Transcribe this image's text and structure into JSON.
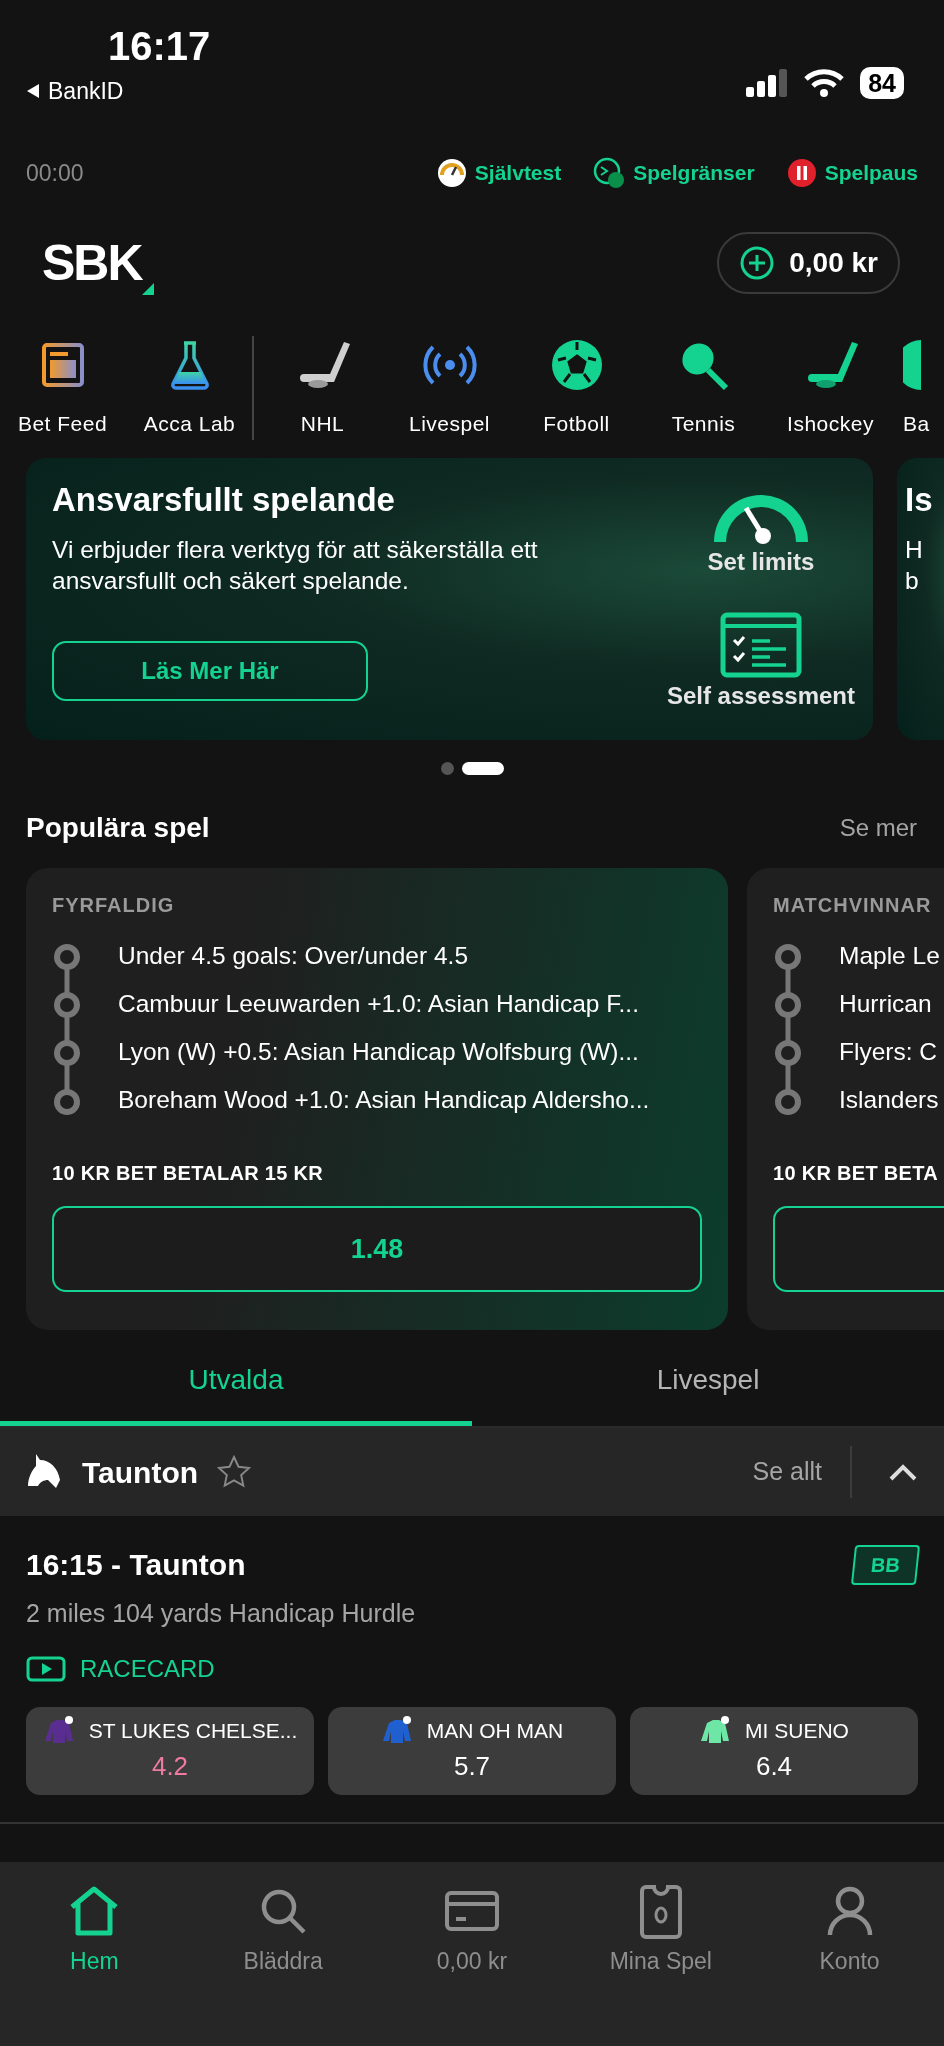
{
  "status_bar": {
    "time": "16:17",
    "back_label": "BankID",
    "battery": "84"
  },
  "top_links": {
    "timer": "00:00",
    "links": [
      {
        "label": "Självtest",
        "kind": "gauge"
      },
      {
        "label": "Spelgränser",
        "kind": "limits"
      },
      {
        "label": "Spelpaus",
        "kind": "pause"
      }
    ]
  },
  "header": {
    "logo": "SBK",
    "balance": "0,00 kr"
  },
  "categories": [
    {
      "label": "Bet Feed",
      "kind": "feed",
      "divider_after": false
    },
    {
      "label": "Acca Lab",
      "kind": "flask",
      "divider_after": true
    },
    {
      "label": "NHL",
      "kind": "hockey-grey",
      "divider_after": false
    },
    {
      "label": "Livespel",
      "kind": "live",
      "divider_after": false
    },
    {
      "label": "Fotboll",
      "kind": "football",
      "divider_after": false
    },
    {
      "label": "Tennis",
      "kind": "tennis",
      "divider_after": false
    },
    {
      "label": "Ishockey",
      "kind": "hockey",
      "divider_after": false
    },
    {
      "label": "Ba",
      "kind": "ball",
      "divider_after": false
    }
  ],
  "banners": [
    {
      "title": "Ansvarsfullt spelande",
      "text": "Vi erbjuder flera verktyg för att säkerställa ett ansvarsfullt och säkert spelande.",
      "button": "Läs Mer Här",
      "features": [
        {
          "label": "Set limits",
          "kind": "gauge"
        },
        {
          "label": "Self assessment",
          "kind": "checklist"
        }
      ]
    },
    {
      "title": "Is",
      "lines": [
        "H",
        "b"
      ]
    }
  ],
  "carousel_dots": [
    {
      "selected": false
    },
    {
      "selected": true
    }
  ],
  "popular": {
    "title": "Populära spel",
    "more": "Se mer",
    "cards": [
      {
        "type": "FYRFALDIG",
        "legs": [
          "Under 4.5 goals: Over/under 4.5",
          "Cambuur Leeuwarden +1.0: Asian Handicap F...",
          "Lyon (W) +0.5: Asian Handicap Wolfsburg (W)...",
          "Boreham Wood +1.0: Asian Handicap Aldersho..."
        ],
        "payout": "10 KR BET BETALAR 15 KR",
        "odds": "1.48"
      },
      {
        "type": "MATCHVINNAR",
        "legs": [
          "Maple Le",
          "Hurrican",
          "Flyers: C",
          "Islanders"
        ],
        "payout": "10 KR BET BETA"
      }
    ]
  },
  "tabs": [
    {
      "label": "Utvalda",
      "selected": true
    },
    {
      "label": "Livespel",
      "selected": false
    }
  ],
  "meeting": {
    "name": "Taunton",
    "favorite": false,
    "see_all": "Se allt",
    "expanded": true,
    "race": {
      "title": "16:15 - Taunton",
      "subtitle": "2 miles 104 yards Handicap Hurdle",
      "badge": "BB",
      "racecard": "RACECARD",
      "runners": [
        {
          "name": "ST LUKES CHELSE...",
          "odds": "4.2",
          "drifting": true,
          "color": "#5a2d91"
        },
        {
          "name": "MAN OH MAN",
          "odds": "5.7",
          "drifting": false,
          "color": "#1f5fd0"
        },
        {
          "name": "MI SUENO",
          "odds": "6.4",
          "drifting": false,
          "color": "#6ee6a6"
        }
      ]
    }
  },
  "bottom_nav": [
    {
      "label": "Hem",
      "kind": "home",
      "selected": true
    },
    {
      "label": "Bläddra",
      "kind": "search",
      "selected": false
    },
    {
      "label": "0,00 kr",
      "kind": "card",
      "selected": false
    },
    {
      "label": "Mina Spel",
      "kind": "ticket",
      "selected": false
    },
    {
      "label": "Konto",
      "kind": "user",
      "selected": false
    }
  ]
}
